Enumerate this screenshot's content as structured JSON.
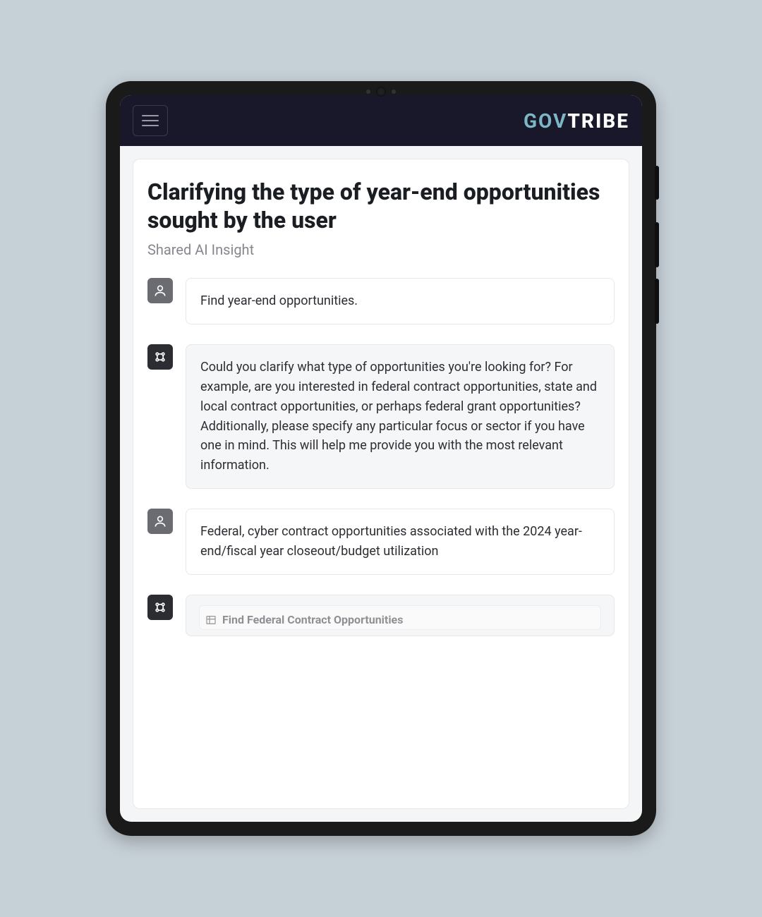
{
  "brand": {
    "part1": "GOV",
    "part2": "TRIBE"
  },
  "page": {
    "title": "Clarifying the type of year-end opportunities sought by the user",
    "subtitle": "Shared AI Insight"
  },
  "conversation": {
    "user1": "Find year-end opportunities.",
    "ai1": "Could you clarify what type of opportunities you're looking for? For example, are you interested in federal contract opportunities, state and local contract opportunities, or perhaps federal grant opportunities? Additionally, please specify any particular focus or sector if you have one in mind. This will help me provide you with the most relevant information.",
    "user2": "Federal, cyber contract opportunities associated with the 2024 year-end/fiscal year closeout/budget utilization",
    "ai2_action": "Find Federal Contract Opportunities"
  },
  "icons": {
    "user": "person-icon",
    "ai": "ai-icon",
    "table": "table-icon"
  }
}
